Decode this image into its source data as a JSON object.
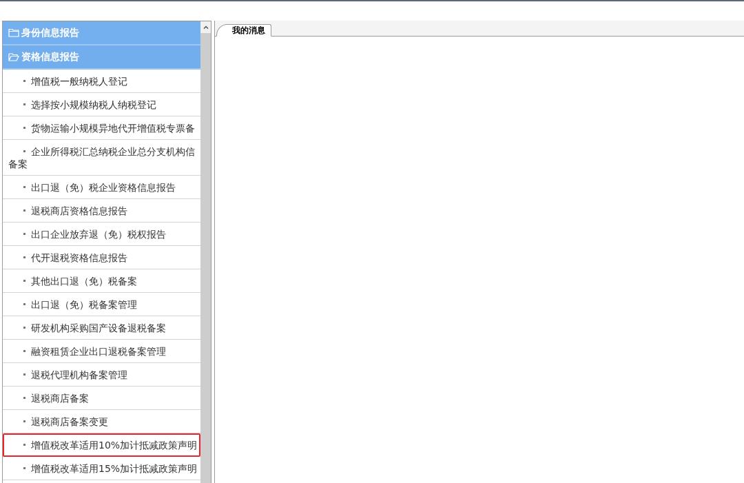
{
  "sidebar": {
    "groups": [
      {
        "label": "身份信息报告",
        "expanded": false
      },
      {
        "label": "资格信息报告",
        "expanded": true
      }
    ],
    "items": [
      {
        "lines": [
          "增值税一般纳税人登记"
        ],
        "highlighted": false
      },
      {
        "lines": [
          "选择按小规模纳税人纳税登记"
        ],
        "highlighted": false
      },
      {
        "lines": [
          "货物运输小规模异地代开增值税专票备"
        ],
        "highlighted": false
      },
      {
        "lines": [
          "企业所得税汇总纳税企业总分支机构信",
          "备案"
        ],
        "highlighted": false
      },
      {
        "lines": [
          "出口退（免）税企业资格信息报告"
        ],
        "highlighted": false
      },
      {
        "lines": [
          "退税商店资格信息报告"
        ],
        "highlighted": false
      },
      {
        "lines": [
          "出口企业放弃退（免）税权报告"
        ],
        "highlighted": false
      },
      {
        "lines": [
          "代开退税资格信息报告"
        ],
        "highlighted": false
      },
      {
        "lines": [
          "其他出口退（免）税备案"
        ],
        "highlighted": false
      },
      {
        "lines": [
          "出口退（免）税备案管理"
        ],
        "highlighted": false
      },
      {
        "lines": [
          "研发机构采购国产设备退税备案"
        ],
        "highlighted": false
      },
      {
        "lines": [
          "融资租赁企业出口退税备案管理"
        ],
        "highlighted": false
      },
      {
        "lines": [
          "退税代理机构备案管理"
        ],
        "highlighted": false
      },
      {
        "lines": [
          "退税商店备案"
        ],
        "highlighted": false
      },
      {
        "lines": [
          "退税商店备案变更"
        ],
        "highlighted": false
      },
      {
        "lines": [
          "增值税改革适用10%加计抵减政策声明"
        ],
        "highlighted": true
      },
      {
        "lines": [
          "增值税改革适用15%加计抵减政策声明"
        ],
        "highlighted": false
      }
    ]
  },
  "tabs": [
    {
      "label": "我的消息",
      "selected": true
    }
  ]
}
